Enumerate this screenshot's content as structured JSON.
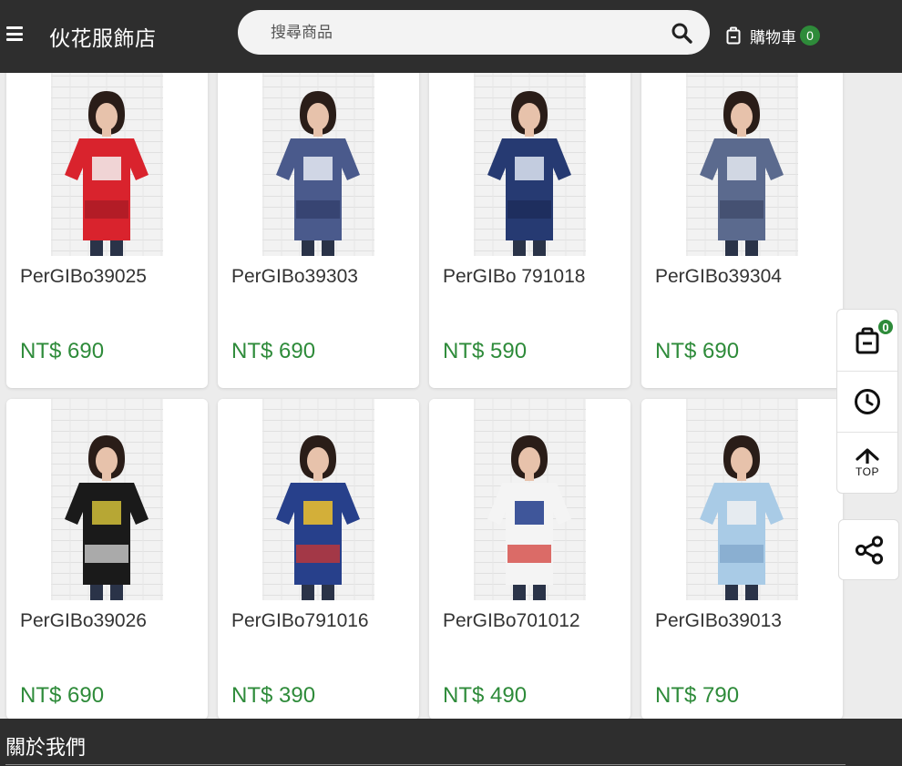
{
  "header": {
    "shop_name": "伙花服飾店",
    "search_placeholder": "搜尋商品",
    "cart_label": "購物車",
    "cart_count": "0"
  },
  "products": [
    {
      "name": "PerGIBo39025",
      "price": "NT$ 690",
      "colors": [
        "#d9232d",
        "#f3f3f3",
        "#a31a24"
      ]
    },
    {
      "name": "PerGIBo39303",
      "price": "NT$ 690",
      "colors": [
        "#4a5a8c",
        "#e8ecf4",
        "#2f3a66"
      ]
    },
    {
      "name": "PerGIBo 791018",
      "price": "NT$ 590",
      "colors": [
        "#263a72",
        "#dfe6f2",
        "#1b2a55"
      ]
    },
    {
      "name": "PerGIBo39304",
      "price": "NT$ 690",
      "colors": [
        "#5b6a8e",
        "#e6eaf2",
        "#3c4766"
      ]
    },
    {
      "name": "PerGIBo39026",
      "price": "NT$ 690",
      "colors": [
        "#1a1a1a",
        "#d4c13a",
        "#e8e8e8"
      ]
    },
    {
      "name": "PerGIBo791016",
      "price": "NT$ 390",
      "colors": [
        "#27408b",
        "#f2c32a",
        "#d8342b"
      ]
    },
    {
      "name": "PerGIBo701012",
      "price": "NT$ 490",
      "colors": [
        "#f4f4f4",
        "#1e3a8a",
        "#d0302b"
      ]
    },
    {
      "name": "PerGIBo39013",
      "price": "NT$ 790",
      "colors": [
        "#a9cbe6",
        "#f1f1f1",
        "#7da3c8"
      ]
    }
  ],
  "float_panel": {
    "cart_count": "0",
    "top_label": "TOP"
  },
  "footer": {
    "title": "關於我們"
  }
}
